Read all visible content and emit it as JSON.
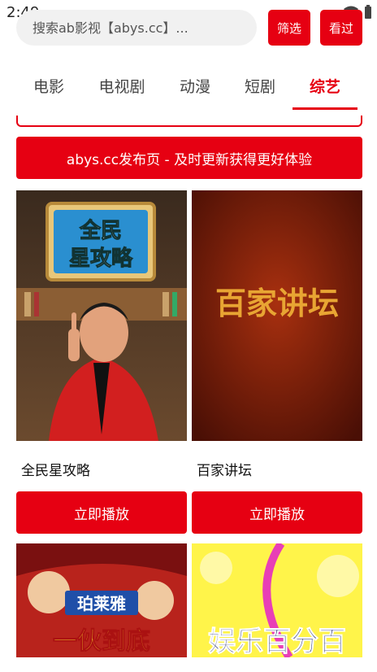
{
  "status_bar": {
    "time": "2:49"
  },
  "search": {
    "placeholder": "搜索ab影视【abys.cc】..."
  },
  "header_buttons": {
    "filter_label": "筛选",
    "history_label": "看过"
  },
  "tabs": [
    {
      "label": "电影",
      "active": false
    },
    {
      "label": "电视剧",
      "active": false
    },
    {
      "label": "动漫",
      "active": false
    },
    {
      "label": "短剧",
      "active": false
    },
    {
      "label": "综艺",
      "active": true
    }
  ],
  "banner": {
    "label": "abys.cc发布页 - 及时更新获得更好体验"
  },
  "cards": [
    {
      "title": "全民星攻略",
      "poster_text": "全民\n星攻略",
      "play_label": "立即播放"
    },
    {
      "title": "百家讲坛",
      "poster_text": "百家讲坛",
      "play_label": "立即播放"
    }
  ],
  "next_row_posters": [
    {
      "poster_text": "珀莱雅"
    },
    {
      "poster_text": "娱乐百分百"
    }
  ],
  "colors": {
    "accent": "#e60012",
    "search_bg": "#f1f1f1"
  }
}
